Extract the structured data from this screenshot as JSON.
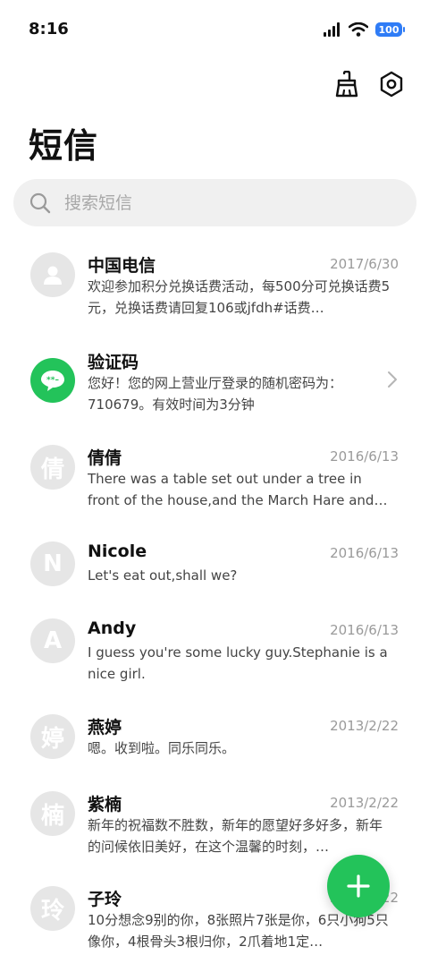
{
  "status_bar": {
    "time": "8:16",
    "battery": "100",
    "battery_color": "#2f7cf6"
  },
  "toolbar": {
    "icons": [
      "broom-icon",
      "settings-icon"
    ]
  },
  "page": {
    "title": "短信"
  },
  "search": {
    "placeholder": "搜索短信"
  },
  "accent_color": "#23c35a",
  "messages": [
    {
      "avatar_type": "person-icon",
      "name": "中国电信",
      "date": "2017/6/30",
      "preview": "欢迎参加积分兑换话费活动，每500分可兑换话费5元，兑换话费请回复106或jfdh#话费…"
    },
    {
      "avatar_type": "chat-bubble-icon",
      "name": "验证码",
      "preview": "您好！您的网上营业厅登录的随机密码为：710679。有效时间为3分钟"
    },
    {
      "avatar": "倩",
      "name": "倩倩",
      "date": "2016/6/13",
      "preview": "There was a table set out under a tree in front of the house,and the March Hare and…"
    },
    {
      "avatar": "N",
      "name": "Nicole",
      "date": "2016/6/13",
      "preview": "Let's eat out,shall we?"
    },
    {
      "avatar": "A",
      "name": "Andy",
      "date": "2016/6/13",
      "preview": "I guess you're some lucky guy.Stephanie is a nice girl."
    },
    {
      "avatar": "婷",
      "name": "燕婷",
      "date": "2013/2/22",
      "preview": "嗯。收到啦。同乐同乐。"
    },
    {
      "avatar": "楠",
      "name": "紫楠",
      "date": "2013/2/22",
      "preview": "新年的祝福数不胜数，新年的愿望好多好多，新年的问候依旧美好，在这个温馨的时刻，…"
    },
    {
      "avatar": "玲",
      "name": "子玲",
      "date": "2013/2/22",
      "preview": "10分想念9别的你，8张照片7张是你，6只小狗5只像你，4根骨头3根归你，2爪着地1定…"
    }
  ]
}
